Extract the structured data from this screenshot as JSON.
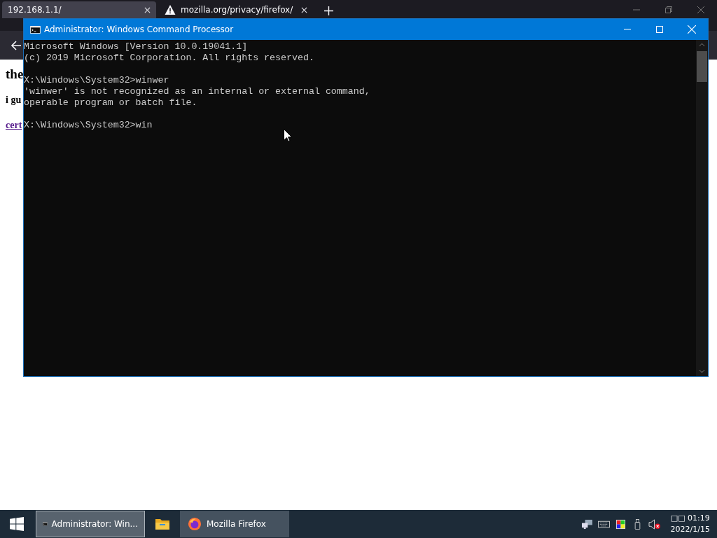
{
  "browser": {
    "tabs": [
      {
        "label": "192.168.1.1/",
        "selected": true,
        "kind": "plain"
      },
      {
        "label": "mozilla.org/privacy/firefox/",
        "selected": false,
        "kind": "warning"
      }
    ],
    "page": [
      {
        "text": "the",
        "kind": "heading"
      },
      {
        "text": "i gu",
        "kind": "bold"
      },
      {
        "text": "cert",
        "kind": "link"
      }
    ]
  },
  "console": {
    "title": "Administrator: Windows Command Processor",
    "blocks": [
      [
        "Microsoft Windows [Version 10.0.19041.1]",
        "(c) 2019 Microsoft Corporation. All rights reserved."
      ],
      [
        "X:\\Windows\\System32>winwer",
        "'winwer' is not recognized as an internal or external command,",
        "operable program or batch file."
      ],
      [
        "X:\\Windows\\System32>win"
      ]
    ]
  },
  "taskbar": {
    "buttons": [
      {
        "kind": "console",
        "label": "Administrator: Win...",
        "selected": true,
        "open": true
      },
      {
        "kind": "folder",
        "selected": false,
        "open": false
      },
      {
        "kind": "firefox",
        "label": "Mozilla Firefox",
        "selected": false,
        "open": true
      }
    ],
    "clock": {
      "time": "□□ 01:19",
      "date": "2022/1/15"
    }
  }
}
